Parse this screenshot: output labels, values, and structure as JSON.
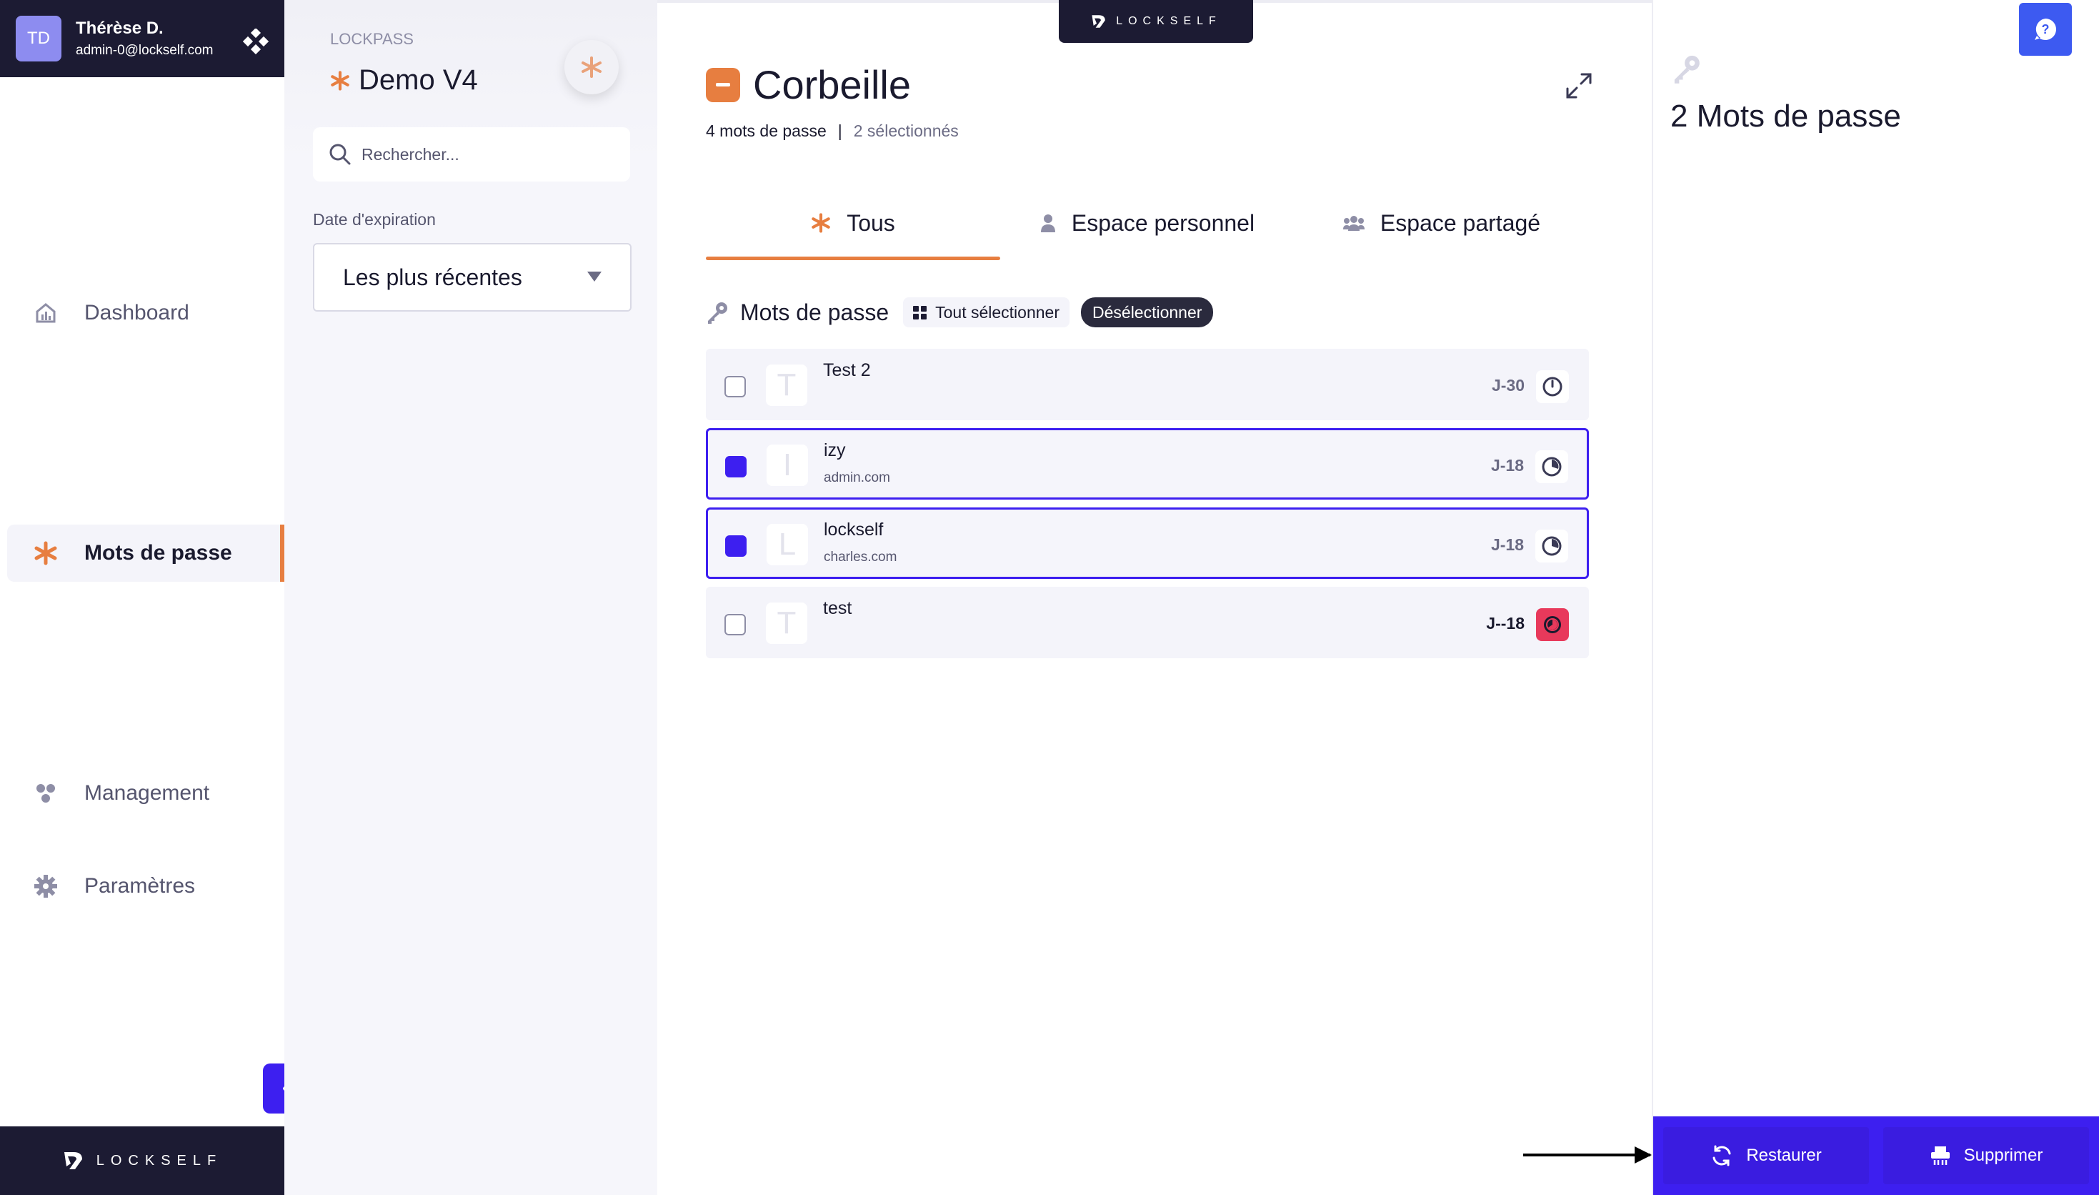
{
  "user": {
    "initials": "TD",
    "name": "Thérèse D.",
    "email": "admin-0@lockself.com"
  },
  "nav": {
    "items": [
      {
        "label": "Dashboard",
        "icon": "dashboard-icon"
      },
      {
        "label": "Mots de passe",
        "icon": "asterisk-icon"
      },
      {
        "label": "Management",
        "icon": "management-icon"
      },
      {
        "label": "Paramètres",
        "icon": "gear-icon"
      }
    ],
    "active": "Mots de passe",
    "brand": "LOCKSELF"
  },
  "filter": {
    "app_label": "LOCKPASS",
    "space_title": "Demo V4",
    "search_placeholder": "Rechercher...",
    "expiration_label": "Date d'expiration",
    "sort_value": "Les plus récentes"
  },
  "main": {
    "brand": "LOCKSELF",
    "title": "Corbeille",
    "count_text": "4 mots de passe",
    "separator": "|",
    "selected_text": "2 sélectionnés",
    "tabs": [
      {
        "label": "Tous",
        "icon": "asterisk-icon"
      },
      {
        "label": "Espace personnel",
        "icon": "person-icon"
      },
      {
        "label": "Espace partagé",
        "icon": "group-icon"
      }
    ],
    "active_tab": "Tous",
    "list_title": "Mots de passe",
    "select_all_label": "Tout sélectionner",
    "deselect_label": "Désélectionner",
    "rows": [
      {
        "letter": "T",
        "name": "Test 2",
        "url": "",
        "expiry": "J-30",
        "selected": false,
        "status": "clock"
      },
      {
        "letter": "I",
        "name": "izy",
        "url": "admin.com",
        "expiry": "J-18",
        "selected": true,
        "status": "clock"
      },
      {
        "letter": "L",
        "name": "lockself",
        "url": "charles.com",
        "expiry": "J-18",
        "selected": true,
        "status": "clock"
      },
      {
        "letter": "T",
        "name": "test",
        "url": "",
        "expiry": "J--18",
        "selected": false,
        "status": "expired"
      }
    ]
  },
  "detail": {
    "title": "2 Mots de passe",
    "restore_label": "Restaurer",
    "delete_label": "Supprimer"
  },
  "colors": {
    "accent_orange": "#e77e40",
    "primary_violet": "#3d1ff0",
    "navy": "#1c1b33",
    "alert_red": "#e8395b",
    "help_blue": "#3d5af1"
  }
}
